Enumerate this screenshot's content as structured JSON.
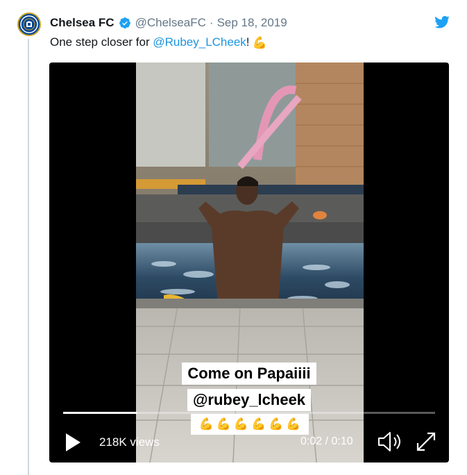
{
  "tweet": {
    "display_name": "Chelsea FC",
    "handle": "@ChelseaFC",
    "separator": "·",
    "date": "Sep 18, 2019",
    "text_prefix": "One step closer for ",
    "mention": "@Rubey_LCheek",
    "text_suffix": "!",
    "emoji": "💪",
    "avatar_icon": "chelsea-crest-icon",
    "verified_icon": "verified-badge-icon",
    "brand_icon": "twitter-bird-icon"
  },
  "video": {
    "caption_line1": "Come on Papaiiii",
    "caption_line2": "@rubey_lcheek",
    "caption_emojis": [
      "💪",
      "💪",
      "💪",
      "💪",
      "💪",
      "💪"
    ],
    "views": "218K views",
    "time": "0:02 / 0:10",
    "progress": 0.2,
    "play_icon": "play-icon",
    "volume_icon": "volume-icon",
    "fullscreen_icon": "fullscreen-icon"
  },
  "colors": {
    "link": "#1b95e0",
    "verified": "#1da1f2",
    "meta_text": "#657786",
    "crest_blue": "#034694"
  }
}
